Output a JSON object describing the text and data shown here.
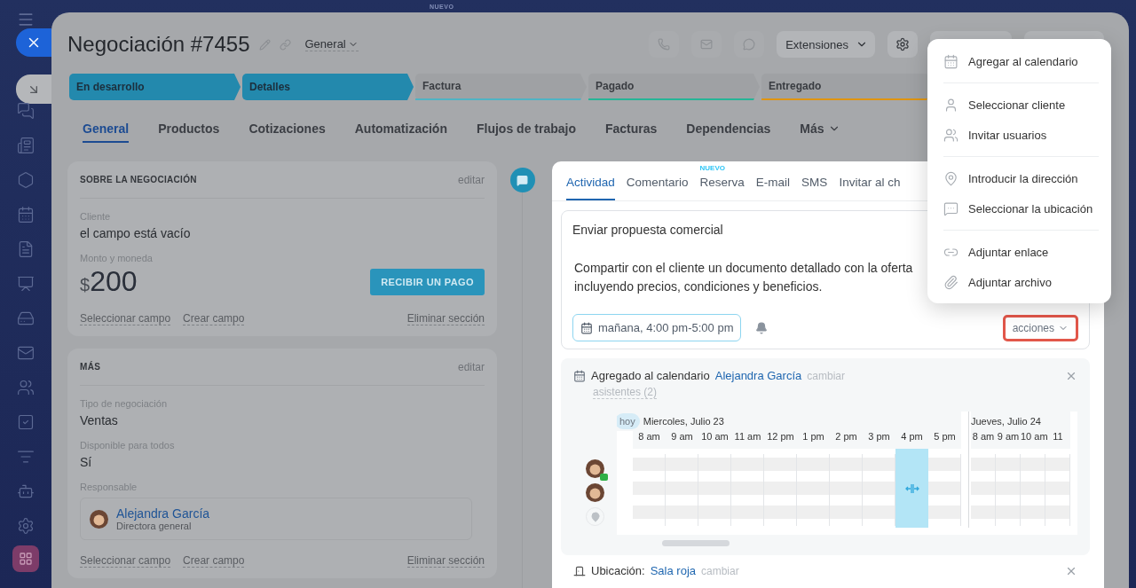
{
  "topbar": {
    "badge": "NUEVO"
  },
  "deal": {
    "title": "Negociación #7455",
    "category": "General",
    "extensions": "Extensiones"
  },
  "stages": [
    {
      "label": "En desarrollo",
      "passed": true,
      "color": "#2389ad"
    },
    {
      "label": "Detalles",
      "passed": true,
      "color": "#2389ad"
    },
    {
      "label": "Factura",
      "passed": false,
      "color": "#4fb3c4"
    },
    {
      "label": "Pagado",
      "passed": false,
      "color": "#26b597"
    },
    {
      "label": "Entregado",
      "passed": false,
      "color": "#e0950f"
    }
  ],
  "tabs": [
    {
      "label": "General",
      "selected": true,
      "dropdown": false
    },
    {
      "label": "Productos",
      "selected": false,
      "dropdown": false
    },
    {
      "label": "Cotizaciones",
      "selected": false,
      "dropdown": false
    },
    {
      "label": "Automatización",
      "selected": false,
      "dropdown": false
    },
    {
      "label": "Flujos de trabajo",
      "selected": false,
      "dropdown": false
    },
    {
      "label": "Facturas",
      "selected": false,
      "dropdown": false
    },
    {
      "label": "Dependencias",
      "selected": false,
      "dropdown": false
    },
    {
      "label": "Más",
      "selected": false,
      "dropdown": true
    }
  ],
  "sections": [
    {
      "title": "SOBRE LA NEGOCIACIÓN",
      "edit": "editar",
      "fields": [
        {
          "kind": "text",
          "label": "Cliente",
          "value": "el campo está vacío"
        },
        {
          "kind": "money",
          "label": "Monto y moneda",
          "currency": "$",
          "value": "200",
          "button": "RECIBIR UN PAGO"
        }
      ],
      "links": [
        "Seleccionar campo",
        "Crear campo"
      ],
      "remove": "Eliminar sección"
    },
    {
      "title": "MÁS",
      "edit": "editar",
      "fields": [
        {
          "kind": "text",
          "label": "Tipo de negociación",
          "value": "Ventas"
        },
        {
          "kind": "text",
          "label": "Disponible para todos",
          "value": "Sí"
        },
        {
          "kind": "user",
          "label": "Responsable",
          "name": "Alejandra García",
          "role": "Directora general"
        }
      ],
      "links": [
        "Seleccionar campo",
        "Crear campo"
      ],
      "remove": "Eliminar sección"
    }
  ],
  "activity": {
    "tabs": [
      {
        "label": "Actividad",
        "selected": true
      },
      {
        "label": "Comentario",
        "selected": false
      },
      {
        "label": "Reserva",
        "selected": false,
        "badge": "NUEVO"
      },
      {
        "label": "E-mail",
        "selected": false
      },
      {
        "label": "SMS",
        "selected": false
      },
      {
        "label": "Invitar al ch",
        "selected": false
      }
    ],
    "editor": {
      "title": "Enviar propuesta comercial",
      "description": "Compartir con el cliente un documento detallado con la oferta incluyendo precios, condiciones y beneficios.",
      "date": "mañana, 4:00 pm-5:00 pm",
      "actions": "acciones",
      "actions_highlighted": true
    },
    "calendar_entry": {
      "title": "Agregado al calendario",
      "user": "Alejandra García",
      "change": "cambiar",
      "attendees": "asistentes (2)",
      "days": [
        {
          "label": "Miercoles, Julio 23",
          "badge": "hoy",
          "hours": [
            {
              "label": "8 am",
              "selected": false
            },
            {
              "label": "9 am",
              "selected": false
            },
            {
              "label": "10 am",
              "selected": false
            },
            {
              "label": "11 am",
              "selected": false
            },
            {
              "label": "12 pm",
              "selected": false
            },
            {
              "label": "1 pm",
              "selected": false
            },
            {
              "label": "2 pm",
              "selected": false
            },
            {
              "label": "3 pm",
              "selected": false
            },
            {
              "label": "4 pm",
              "selected": true
            },
            {
              "label": "5 pm",
              "selected": false
            }
          ]
        },
        {
          "label": "Jueves, Julio 24",
          "hours": [
            {
              "label": "8 am",
              "selected": false
            },
            {
              "label": "9 am",
              "selected": false
            },
            {
              "label": "10 am",
              "selected": false
            },
            {
              "label": "11",
              "selected": false
            }
          ]
        }
      ],
      "rows": [
        {
          "kind": "person",
          "owner": true
        },
        {
          "kind": "person",
          "owner": false
        },
        {
          "kind": "location"
        }
      ]
    },
    "location_entry": {
      "label": "Ubicación:",
      "value": "Sala roja",
      "change": "cambiar"
    }
  },
  "actions_menu": {
    "groups": [
      [
        {
          "kind": "calendar",
          "label": "Agregar al calendario"
        }
      ],
      [
        {
          "kind": "client",
          "label": "Seleccionar cliente"
        },
        {
          "kind": "users",
          "label": "Invitar usuarios"
        }
      ],
      [
        {
          "kind": "address",
          "label": "Introducir la dirección"
        },
        {
          "kind": "place",
          "label": "Seleccionar la ubicación"
        }
      ],
      [
        {
          "kind": "link",
          "label": "Adjuntar enlace"
        },
        {
          "kind": "file",
          "label": "Adjuntar archivo"
        }
      ]
    ]
  }
}
